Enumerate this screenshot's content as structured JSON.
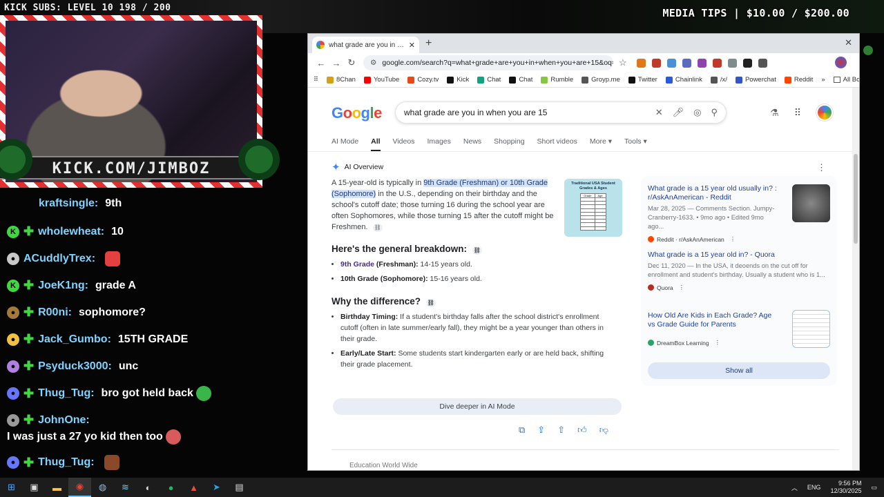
{
  "overlay": {
    "subs": "KICK SUBS: LEVEL 10 198 / 200",
    "tips": "MEDIA TIPS | $10.00 / $200.00",
    "cam_banner": "KICK.COM/JIMBOZ"
  },
  "chat": [
    {
      "user": "kraftsingle:",
      "text": "9th",
      "badge_color": "#3fd93f"
    },
    {
      "user": "wholewheat:",
      "text": "10",
      "badge_color": "#3fd93f"
    },
    {
      "user": "ACuddlyTrex:",
      "text": "",
      "badge_color": "#c8c8c8"
    },
    {
      "user": "JoeK1ng:",
      "text": "grade A",
      "badge_color": "#3fd93f"
    },
    {
      "user": "R00ni:",
      "text": "sophomore?",
      "badge_color": "#a37a3a"
    },
    {
      "user": "Jack_Gumbo:",
      "text": "15TH GRADE",
      "badge_color": "#f0c040"
    },
    {
      "user": "Psyduck3000:",
      "text": "unc",
      "badge_color": "#b080e0"
    },
    {
      "user": "Thug_Tug:",
      "text": "bro got held back",
      "badge_color": "#6677ff"
    },
    {
      "user": "JohnOne:",
      "text": "",
      "badge_color": "#999999"
    },
    {
      "user": "",
      "text": "I was just a 27 yo kid then too",
      "badge_color": ""
    },
    {
      "user": "Thug_Tug:",
      "text": "",
      "badge_color": "#6677ff"
    }
  ],
  "browser": {
    "tab_title": "what grade are you in when yo",
    "url": "google.com/search?q=what+grade+are+you+in+when+you+are+15&oq=...",
    "bookmarks": [
      {
        "label": "8Chan",
        "color": "#d4a017"
      },
      {
        "label": "YouTube",
        "color": "#ff0000"
      },
      {
        "label": "Cozy.tv",
        "color": "#e64a19"
      },
      {
        "label": "Kick",
        "color": "#111111"
      },
      {
        "label": "Chat",
        "color": "#10a37f"
      },
      {
        "label": "Chat",
        "color": "#111111"
      },
      {
        "label": "Rumble",
        "color": "#85c742"
      },
      {
        "label": "Groyp.me",
        "color": "#555555"
      },
      {
        "label": "Twitter",
        "color": "#111111"
      },
      {
        "label": "Chainlink",
        "color": "#2a5ada"
      },
      {
        "label": "/x/",
        "color": "#555555"
      },
      {
        "label": "Powerchat",
        "color": "#3355cc"
      },
      {
        "label": "Reddit",
        "color": "#ff4500"
      }
    ],
    "all_bookmarks": "All Bookmarks"
  },
  "google": {
    "logo": "Google",
    "query": "what grade are you in when you are 15",
    "filters": [
      "AI Mode",
      "All",
      "Videos",
      "Images",
      "News",
      "Shopping",
      "Short videos",
      "More",
      "Tools"
    ],
    "active_filter": "All",
    "ai_overview_label": "AI Overview",
    "ai_intro": "A 15-year-old is typically in",
    "ai_highlight": "9th Grade (Freshman) or 10th Grade (Sophomore)",
    "ai_rest": "in the U.S., depending on their birthday and the school's cutoff date; those turning 16 during the school year are often Sophomores, while those turning 15 after the cutoff might be Freshmen.",
    "chart_title": "Traditional USA Student Grades & Ages",
    "chart_headers": [
      "Grade",
      "Age"
    ],
    "breakdown_heading": "Here's the general breakdown:",
    "breakdown": [
      {
        "link": "9th Grade",
        "bold": " (Freshman):",
        "text": " 14-15 years old."
      },
      {
        "link": "10th Grade",
        "bold": " (Sophomore):",
        "text": " 15-16 years old."
      }
    ],
    "why_heading": "Why the difference?",
    "why": [
      {
        "bold": "Birthday Timing:",
        "text": " If a student's birthday falls after the school district's enrollment cutoff (often in late summer/early fall), they might be a year younger than others in their grade."
      },
      {
        "bold": "Early/Late Start:",
        "text": " Some students start kindergarten early or are held back, shifting their grade placement."
      }
    ],
    "dive_deeper": "Dive deeper in AI Mode",
    "cutoff_text": "Education World Wide",
    "sources": [
      {
        "title": "What grade is a 15 year old usually in? : r/AskAnAmerican - Reddit",
        "desc": "Mar 28, 2025 — Comments Section. Jumpy-Cranberry-1633. • 9mo ago • Edited 9mo ago...",
        "site": "Reddit · r/AskAnAmerican",
        "color": "#ff4500"
      },
      {
        "title": "What grade is a 15 year old in? - Quora",
        "desc": "Dec 11, 2020 — In the USA, it deoends on the cut off for enrollment and student's birthday. Usually a student who is 1...",
        "site": "Quora",
        "color": "#b92b27"
      },
      {
        "title": "How Old Are Kids in Each Grade? Age vs Grade Guide for Parents",
        "desc": "",
        "site": "DreamBox Learning",
        "color": "#2aa36b"
      }
    ],
    "show_all": "Show all"
  },
  "taskbar": {
    "lang": "ENG",
    "time": "9:56 PM",
    "date": "12/30/2025"
  }
}
